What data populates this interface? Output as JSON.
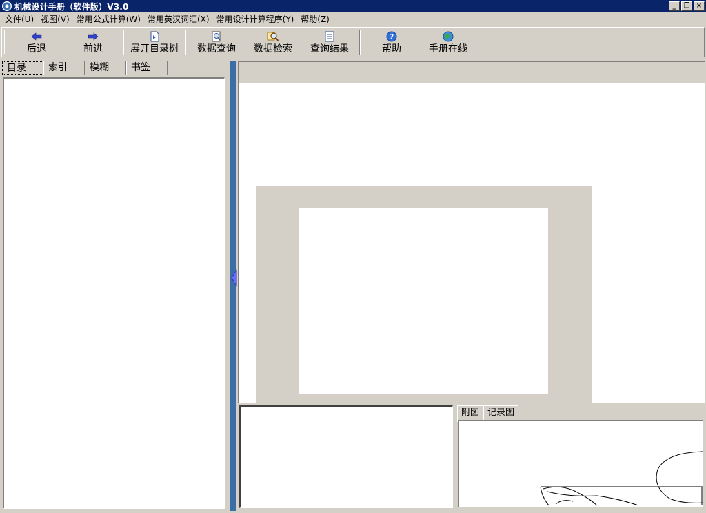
{
  "window": {
    "title": "机械设计手册（软件版）V3.0",
    "buttons": [
      "_",
      "❐",
      "×"
    ]
  },
  "menu": [
    "文件(U)",
    "视图(V)",
    "常用公式计算(W)",
    "常用英汉词汇(X)",
    "常用设计计算程序(Y)",
    "帮助(Z)"
  ],
  "toolbar": {
    "back": "后退",
    "forward": "前进",
    "expand_tree": "展开目录树",
    "data_query": "数据查询",
    "data_search": "数据检索",
    "query_results": "查询结果",
    "help": "帮助",
    "online_manual": "手册在线"
  },
  "left_tabs": [
    "目录",
    "索引",
    "模糊",
    "书签"
  ],
  "bottom_tabs": [
    "附图",
    "记录图"
  ],
  "colors": {
    "titlebar": "#0a246a",
    "face": "#d4d0c8",
    "splitter": "#3a6ea5",
    "arrow": "#3344cc"
  }
}
